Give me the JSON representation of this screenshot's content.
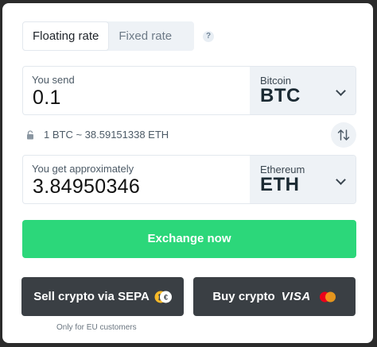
{
  "rate_tabs": [
    {
      "label": "Floating rate",
      "active": true
    },
    {
      "label": "Fixed rate",
      "active": false
    }
  ],
  "help_icon": {
    "glyph": "?"
  },
  "send": {
    "label": "You send",
    "value": "0.1",
    "currency_name": "Bitcoin",
    "currency_code": "BTC"
  },
  "rate": {
    "text": "1 BTC ~ 38.59151338 ETH"
  },
  "get": {
    "label": "You get approximately",
    "value": "3.84950346",
    "currency_name": "Ethereum",
    "currency_code": "ETH"
  },
  "exchange_button": {
    "label": "Exchange now"
  },
  "sell_button": {
    "label": "Sell crypto via SEPA"
  },
  "buy_button": {
    "label": "Buy crypto",
    "brand": "VISA"
  },
  "eu_note": "Only for EU customers",
  "colors": {
    "accent_green": "#2cd77a",
    "dark_button": "#3a3f44",
    "select_bg": "#eef2f6"
  }
}
